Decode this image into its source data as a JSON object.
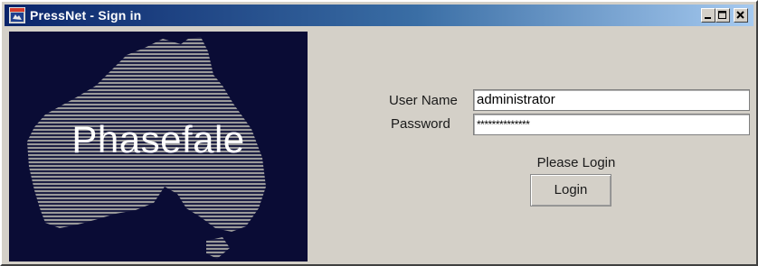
{
  "window": {
    "title": "PressNet - Sign in",
    "controls": {
      "minimize": "minimize-icon",
      "maximize": "maximize-icon",
      "close": "close-icon"
    }
  },
  "banner": {
    "logo_text": "Phasefale",
    "background_color": "#0a0c35",
    "map_icon": "australia-map-icon"
  },
  "form": {
    "username_label": "User Name",
    "username_value": "administrator",
    "password_label": "Password",
    "password_value": "**************",
    "status_text": "Please Login",
    "login_button_label": "Login"
  },
  "colors": {
    "titlebar_start": "#0a246a",
    "titlebar_end": "#a6caf0",
    "window_bg": "#d4d0c8"
  }
}
